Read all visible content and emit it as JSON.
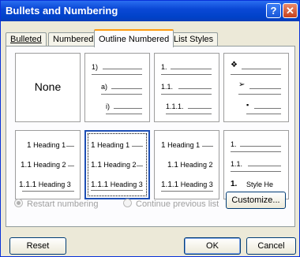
{
  "window": {
    "title": "Bullets and Numbering"
  },
  "tabs": [
    "Bulleted",
    "Numbered",
    "Outline Numbered",
    "List Styles"
  ],
  "active_tab": "Outline Numbered",
  "gallery": {
    "none_label": "None",
    "c1": [
      "1)",
      "a)",
      "i)"
    ],
    "c2": [
      "1.",
      "1.1.",
      "1.1.1."
    ],
    "c3": [
      "❖",
      "➢",
      "▪"
    ],
    "c4": [
      {
        "num": "1",
        "text": "Heading 1"
      },
      {
        "num": "1.1",
        "text": "Heading 2"
      },
      {
        "num": "1.1.1",
        "text": "Heading 3"
      }
    ],
    "c5": [
      {
        "num": "1",
        "text": "Heading 1"
      },
      {
        "num": "1.1",
        "text": "Heading 2"
      },
      {
        "num": "1.1.1",
        "text": "Heading 3"
      }
    ],
    "c6": [
      {
        "num": "1",
        "text": "Heading 1"
      },
      {
        "num": "1.1",
        "text": "Heading 2"
      },
      {
        "num": "1.1.1",
        "text": "Heading 3"
      }
    ],
    "c7": [
      "1.",
      "1.1.",
      "1.",
      "Style He"
    ]
  },
  "options": {
    "restart": "Restart numbering",
    "continue": "Continue previous list"
  },
  "buttons": {
    "customize": "Customize...",
    "reset": "Reset",
    "ok": "OK",
    "cancel": "Cancel"
  }
}
